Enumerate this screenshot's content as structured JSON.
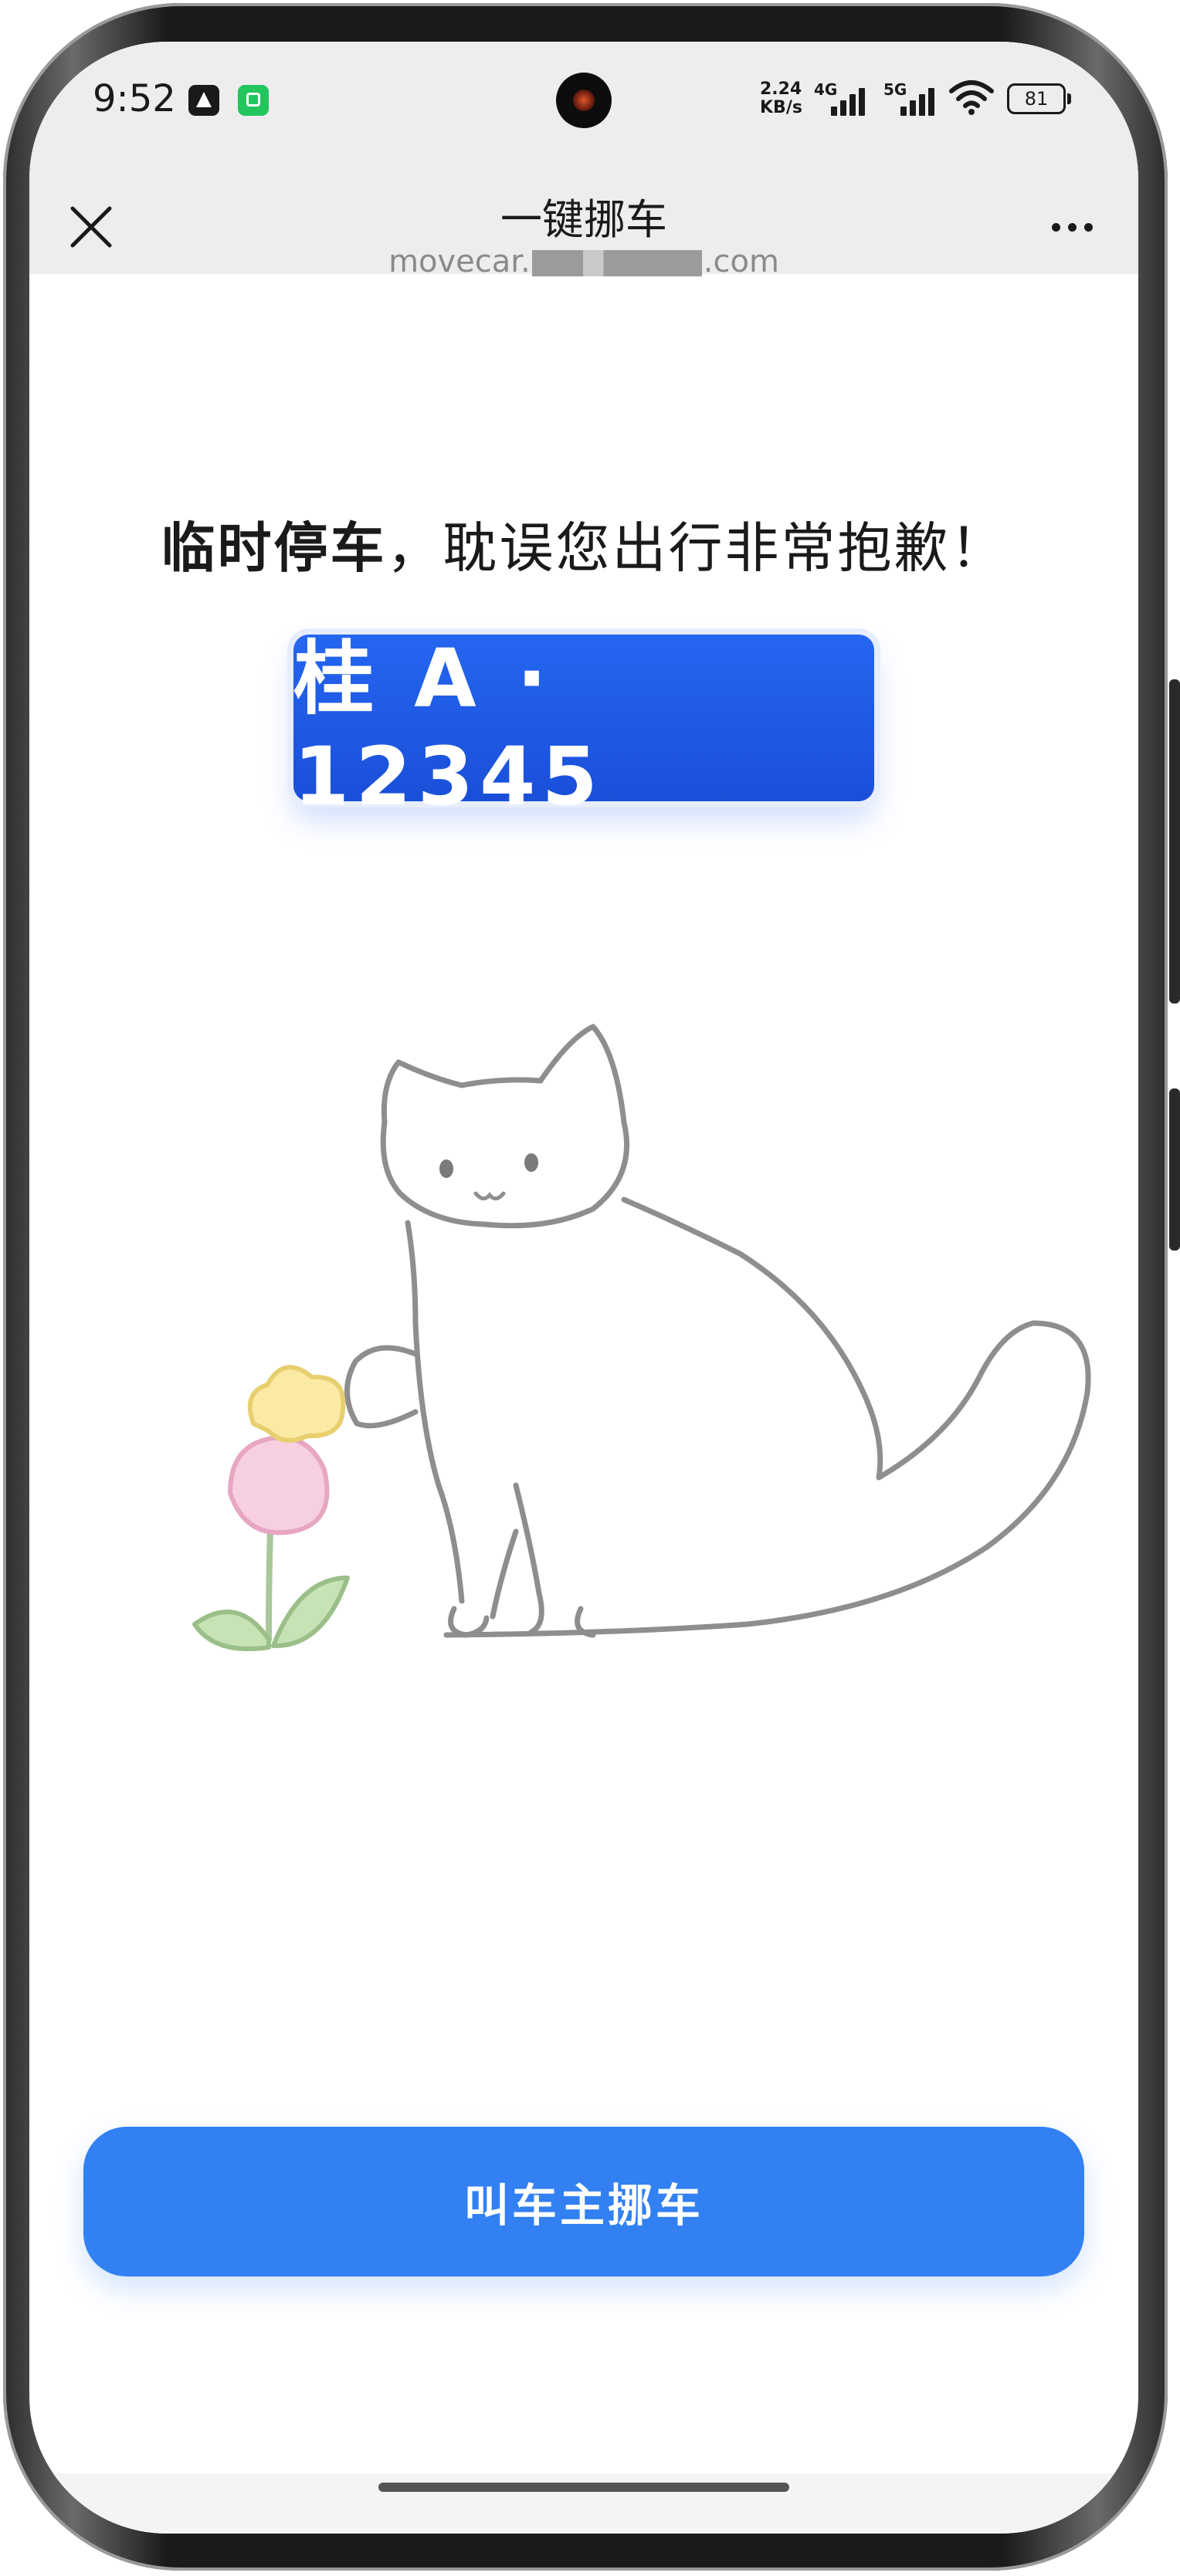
{
  "status_bar": {
    "time": "9:52",
    "net_speed_value": "2.24",
    "net_speed_unit": "KB/s",
    "signal_1_label": "4G",
    "signal_2_label": "5G",
    "battery": "81",
    "icons": [
      "app-notification-icon",
      "app-notification-icon-green",
      "cellular-signal-icon",
      "wifi-icon",
      "battery-icon"
    ]
  },
  "nav": {
    "title": "一键挪车",
    "url_prefix": "movecar.",
    "url_suffix": ".com",
    "close_icon": "close-icon",
    "more_icon": "more-icon"
  },
  "page": {
    "apology_bold": "临时停车",
    "apology_rest": "，耽误您出行非常抱歉！",
    "plate_number": "桂 A · 12345",
    "illustration": "cat-and-flower-illustration",
    "action_label": "叫车主挪车"
  },
  "colors": {
    "plate_blue": "#1a4fd8",
    "button_blue": "#3280f2",
    "header_grey": "#ededed"
  }
}
